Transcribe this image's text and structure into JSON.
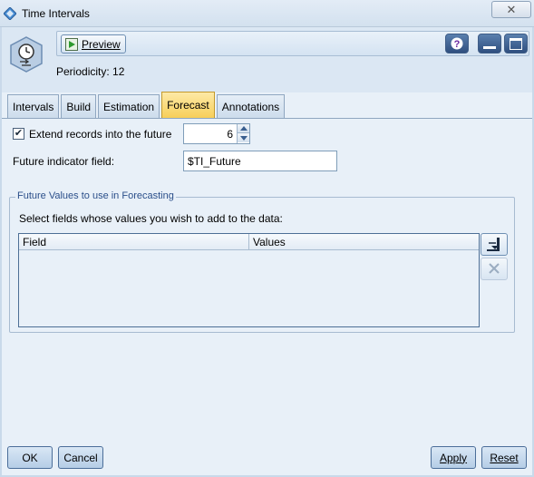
{
  "window": {
    "title": "Time Intervals",
    "close_glyph": "✕"
  },
  "toolbar": {
    "preview_label": "Preview",
    "help_glyph": "?"
  },
  "header": {
    "periodicity": "Periodicity: 12"
  },
  "tabs": [
    {
      "label": "Intervals",
      "active": false
    },
    {
      "label": "Build",
      "active": false
    },
    {
      "label": "Estimation",
      "active": false
    },
    {
      "label": "Forecast",
      "active": true
    },
    {
      "label": "Annotations",
      "active": false
    }
  ],
  "forecast": {
    "extend_checked": true,
    "extend_label": "Extend records into the future",
    "extend_value": "6",
    "indicator_label": "Future indicator field:",
    "indicator_value": "$TI_Future",
    "group_title": "Future Values to use in Forecasting",
    "group_desc": "Select fields whose values you wish to add to the data:",
    "columns": [
      "Field",
      "Values"
    ]
  },
  "footer": {
    "ok": "OK",
    "cancel": "Cancel",
    "apply": "Apply",
    "reset": "Reset"
  },
  "colors": {
    "active_tab": "#f7cf59",
    "accent_blue": "#2f4f7f",
    "group_title": "#2b4f8a"
  },
  "icons": {
    "app": "spss-diamond-icon",
    "node": "time-intervals-node-icon",
    "preview": "play-icon",
    "help": "help-icon",
    "minimize": "minimize-icon",
    "maximize": "maximize-icon",
    "add_field": "field-picker-icon",
    "remove": "delete-icon"
  }
}
